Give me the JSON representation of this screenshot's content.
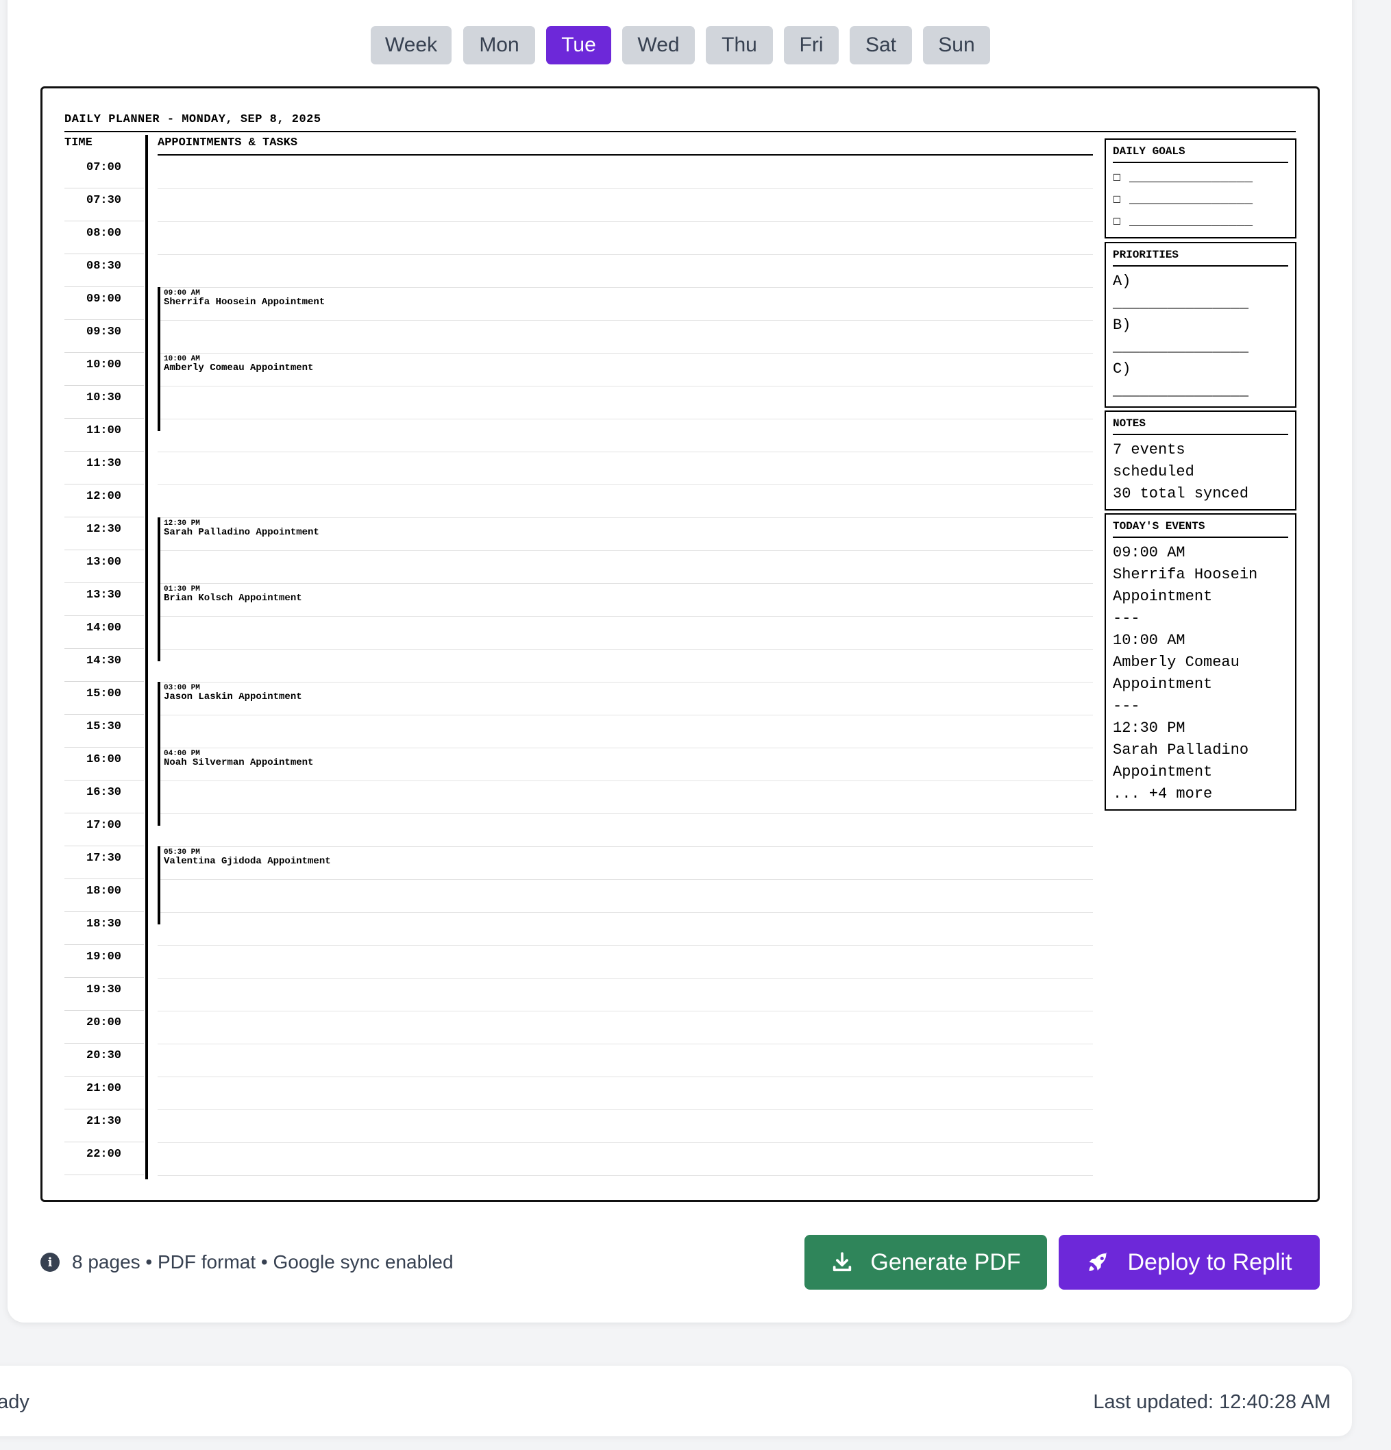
{
  "tabs": [
    "Week",
    "Mon",
    "Tue",
    "Wed",
    "Thu",
    "Fri",
    "Sat",
    "Sun"
  ],
  "active_tab": "Tue",
  "planner": {
    "title": "DAILY PLANNER - MONDAY, SEP 8, 2025",
    "time_header": "TIME",
    "appointments_header": "APPOINTMENTS & TASKS",
    "times": [
      "07:00",
      "07:30",
      "08:00",
      "08:30",
      "09:00",
      "09:30",
      "10:00",
      "10:30",
      "11:00",
      "11:30",
      "12:00",
      "12:30",
      "13:00",
      "13:30",
      "14:00",
      "14:30",
      "15:00",
      "15:30",
      "16:00",
      "16:30",
      "17:00",
      "17:30",
      "18:00",
      "18:30",
      "19:00",
      "19:30",
      "20:00",
      "20:30",
      "21:00",
      "21:30",
      "22:00"
    ],
    "events": [
      {
        "time": "09:00 AM",
        "title": "Sherrifa Hoosein Appointment"
      },
      {
        "time": "10:00 AM",
        "title": "Amberly Comeau Appointment"
      },
      {
        "time": "12:30 PM",
        "title": "Sarah Palladino Appointment"
      },
      {
        "time": "01:30 PM",
        "title": "Brian Kolsch Appointment"
      },
      {
        "time": "03:00 PM",
        "title": "Jason Laskin Appointment"
      },
      {
        "time": "04:00 PM",
        "title": "Noah Silverman Appointment"
      },
      {
        "time": "05:30 PM",
        "title": "Valentina Gjidoda Appointment"
      }
    ],
    "daily_goals": {
      "heading": "DAILY GOALS",
      "items": [
        "☐ _______________",
        "☐ _______________",
        "☐ _______________"
      ]
    },
    "priorities": {
      "heading": "PRIORITIES",
      "text": "A)\n_______________\nB)\n_______________\nC)\n_______________"
    },
    "notes": {
      "heading": "NOTES",
      "text": "7 events\nscheduled\n30 total synced"
    },
    "todays_events": {
      "heading": "TODAY'S EVENTS",
      "text": "09:00 AM\nSherrifa Hoosein\nAppointment\n---\n10:00 AM\nAmberly Comeau\nAppointment\n---\n12:30 PM\nSarah Palladino\nAppointment\n... +4 more"
    }
  },
  "footer": {
    "info_text": "8 pages • PDF format • Google sync enabled",
    "generate_label": "Generate PDF",
    "deploy_label": "Deploy to Replit"
  },
  "status": {
    "left": "eady",
    "right": "Last updated: 12:40:28 AM"
  }
}
